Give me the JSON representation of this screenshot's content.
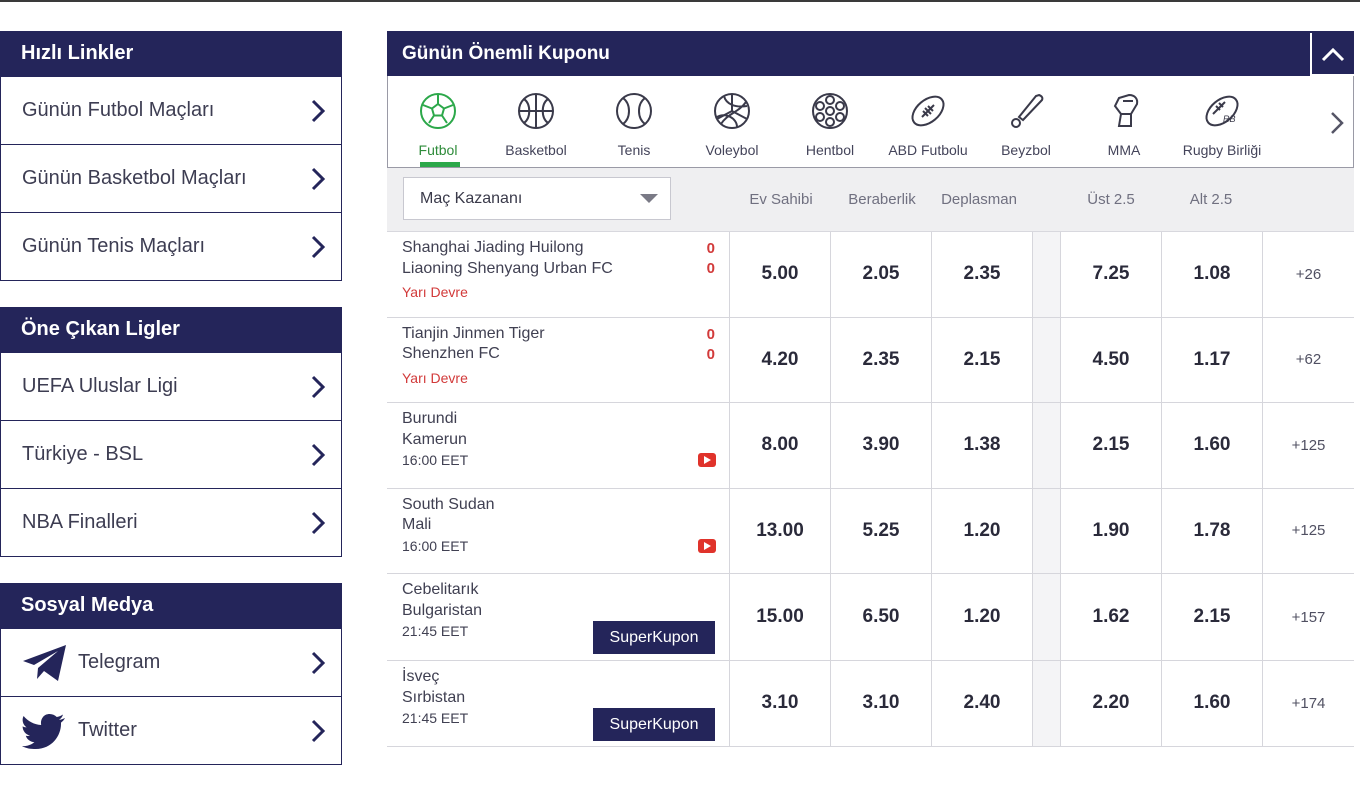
{
  "quick_links": {
    "title": "Hızlı Linkler",
    "items": [
      "Günün Futbol Maçları",
      "Günün Basketbol Maçları",
      "Günün Tenis Maçları"
    ]
  },
  "featured_leagues": {
    "title": "Öne Çıkan Ligler",
    "items": [
      "UEFA Uluslar Ligi",
      "Türkiye - BSL",
      "NBA Finalleri"
    ]
  },
  "social": {
    "title": "Sosyal Medya",
    "items": [
      {
        "label": "Telegram",
        "icon": "telegram-icon"
      },
      {
        "label": "Twitter",
        "icon": "twitter-icon"
      }
    ]
  },
  "coupon": {
    "title": "Günün Önemli Kuponu",
    "sports": [
      {
        "label": "Futbol",
        "icon": "football-icon",
        "active": true
      },
      {
        "label": "Basketbol",
        "icon": "basketball-icon"
      },
      {
        "label": "Tenis",
        "icon": "tennis-icon"
      },
      {
        "label": "Voleybol",
        "icon": "volleyball-icon"
      },
      {
        "label": "Hentbol",
        "icon": "handball-icon"
      },
      {
        "label": "ABD Futbolu",
        "icon": "american-football-icon"
      },
      {
        "label": "Beyzbol",
        "icon": "baseball-icon"
      },
      {
        "label": "MMA",
        "icon": "mma-icon"
      },
      {
        "label": "Rugby Birliği",
        "icon": "rugby-icon"
      }
    ],
    "market": "Maç Kazananı",
    "columns": [
      "Ev Sahibi",
      "Beraberlik",
      "Deplasman",
      "Üst 2.5",
      "Alt 2.5"
    ],
    "matches": [
      {
        "home": "Shanghai Jiading Huilong",
        "away": "Liaoning Shenyang Urban FC",
        "home_score": "0",
        "away_score": "0",
        "status": "Yarı Devre",
        "time": "",
        "odds": [
          "5.00",
          "2.05",
          "2.35",
          "7.25",
          "1.08"
        ],
        "more": "+26"
      },
      {
        "home": "Tianjin Jinmen Tiger",
        "away": "Shenzhen FC",
        "home_score": "0",
        "away_score": "0",
        "status": "Yarı Devre",
        "time": "",
        "odds": [
          "4.20",
          "2.35",
          "2.15",
          "4.50",
          "1.17"
        ],
        "more": "+62"
      },
      {
        "home": "Burundi",
        "away": "Kamerun",
        "status": "",
        "time": "16:00 EET",
        "stream": true,
        "odds": [
          "8.00",
          "3.90",
          "1.38",
          "2.15",
          "1.60"
        ],
        "more": "+125"
      },
      {
        "home": "South Sudan",
        "away": "Mali",
        "status": "",
        "time": "16:00 EET",
        "stream": true,
        "odds": [
          "13.00",
          "5.25",
          "1.20",
          "1.90",
          "1.78"
        ],
        "more": "+125"
      },
      {
        "home": "Cebelitarık",
        "away": "Bulgaristan",
        "status": "",
        "time": "21:45 EET",
        "superkupon": "SuperKupon",
        "odds": [
          "15.00",
          "6.50",
          "1.20",
          "1.62",
          "2.15"
        ],
        "more": "+157"
      },
      {
        "home": "İsveç",
        "away": "Sırbistan",
        "status": "",
        "time": "21:45 EET",
        "superkupon": "SuperKupon",
        "odds": [
          "3.10",
          "3.10",
          "2.40",
          "2.20",
          "1.60"
        ],
        "more": "+174"
      }
    ]
  },
  "colors": {
    "navy": "#24255a",
    "live_red": "#d23a3a",
    "active_green": "#2ca84a"
  }
}
